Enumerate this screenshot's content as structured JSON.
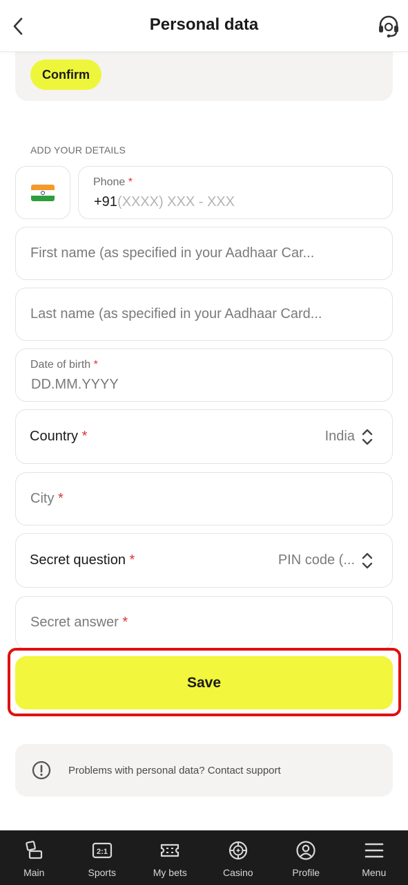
{
  "header": {
    "title": "Personal data"
  },
  "confirm": {
    "button_label": "Confirm"
  },
  "section": {
    "title": "ADD YOUR DETAILS"
  },
  "phone": {
    "label": "Phone",
    "required_mark": "*",
    "prefix": "+91",
    "mask": "(XXXX) XXX - XXX"
  },
  "first_name": {
    "placeholder": "First name (as specified in your Aadhaar Car..."
  },
  "last_name": {
    "placeholder": "Last name (as specified in your Aadhaar Card..."
  },
  "dob": {
    "label": "Date of birth",
    "required_mark": "*",
    "placeholder": "DD.MM.YYYY"
  },
  "country": {
    "label": "Country",
    "required_mark": "*",
    "value": "India"
  },
  "city": {
    "placeholder": "City",
    "required_mark": "*"
  },
  "secret_question": {
    "label": "Secret question",
    "required_mark": "*",
    "value": "PIN code (..."
  },
  "secret_answer": {
    "placeholder": "Secret answer",
    "required_mark": "*"
  },
  "save": {
    "label": "Save"
  },
  "support_notice": {
    "text": "Problems with personal data? Contact support"
  },
  "bottom_nav": {
    "items": [
      {
        "label": "Main",
        "icon": "main-icon"
      },
      {
        "label": "Sports",
        "icon": "sports-icon"
      },
      {
        "label": "My bets",
        "icon": "ticket-icon"
      },
      {
        "label": "Casino",
        "icon": "casino-chip-icon"
      },
      {
        "label": "Profile",
        "icon": "profile-icon"
      },
      {
        "label": "Menu",
        "icon": "menu-icon"
      }
    ]
  },
  "colors": {
    "accent": "#f2f63c",
    "required": "#e03131",
    "highlight_outline": "#e01010",
    "nav_bg": "#1c1c1c"
  }
}
